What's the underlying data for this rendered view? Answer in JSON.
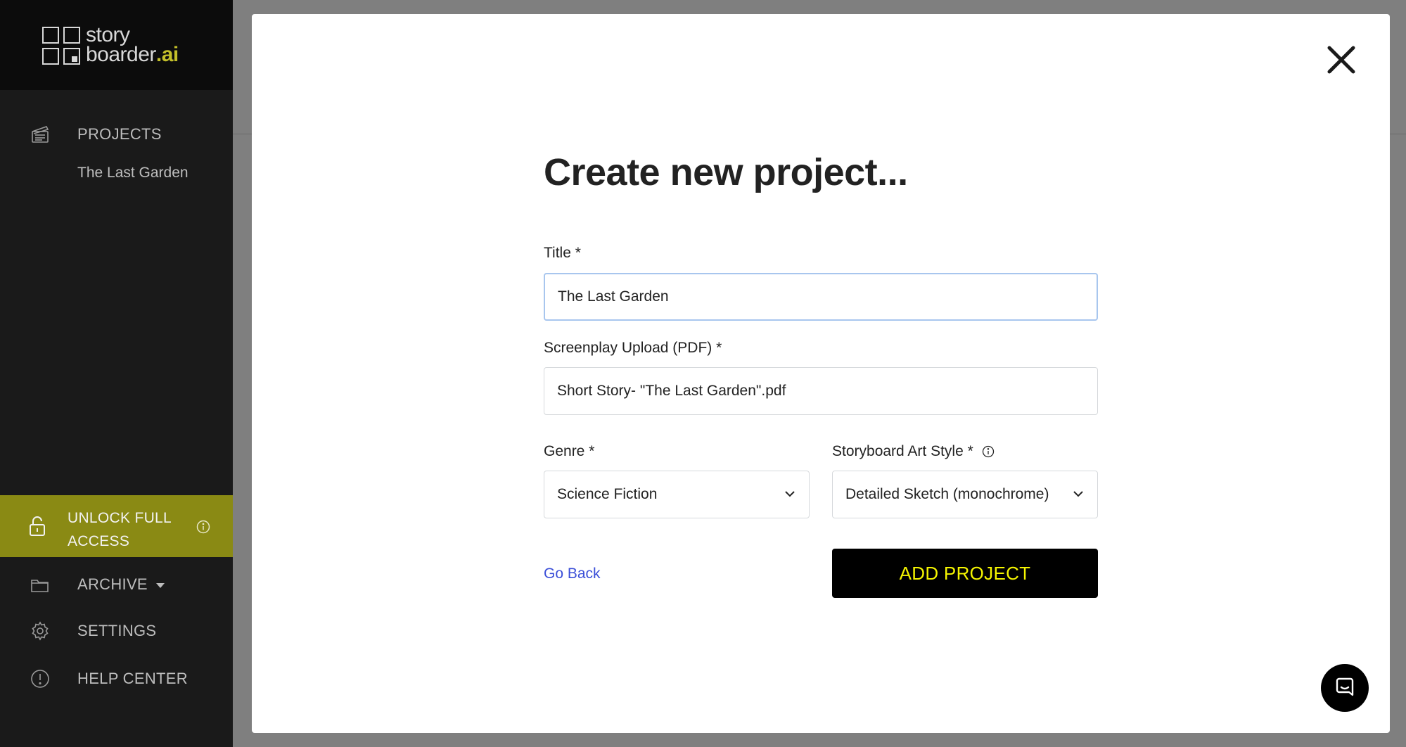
{
  "sidebar": {
    "logo_line1": "story",
    "logo_line2": "boarder",
    "logo_ai": ".ai",
    "projects_label": "PROJECTS",
    "project_item": "The Last Garden",
    "unlock_line1": "UNLOCK FULL",
    "unlock_line2": "ACCESS",
    "archive_label": "ARCHIVE",
    "settings_label": "SETTINGS",
    "help_label": "HELP CENTER"
  },
  "modal": {
    "title": "Create new project...",
    "title_label": "Title *",
    "title_value": "The Last Garden",
    "screenplay_label": "Screenplay Upload (PDF) *",
    "screenplay_value": "Short Story- \"The Last Garden\".pdf",
    "genre_label": "Genre *",
    "genre_value": "Science Fiction",
    "art_style_label": "Storyboard Art Style *",
    "art_style_value": "Detailed Sketch (monochrome)",
    "go_back": "Go Back",
    "add_project": "ADD PROJECT"
  },
  "colors": {
    "sidebar_bg": "#1a1a1a",
    "unlock_bg": "#8a8a14",
    "logo_accent": "#c4c02a",
    "button_text": "#f5f500",
    "link": "#3b4fd8"
  },
  "icons": [
    "clapperboard-icon",
    "lock-icon",
    "info-icon",
    "folder-icon",
    "gear-icon",
    "alert-circle-icon",
    "close-icon",
    "chevron-down-icon",
    "chat-icon"
  ]
}
